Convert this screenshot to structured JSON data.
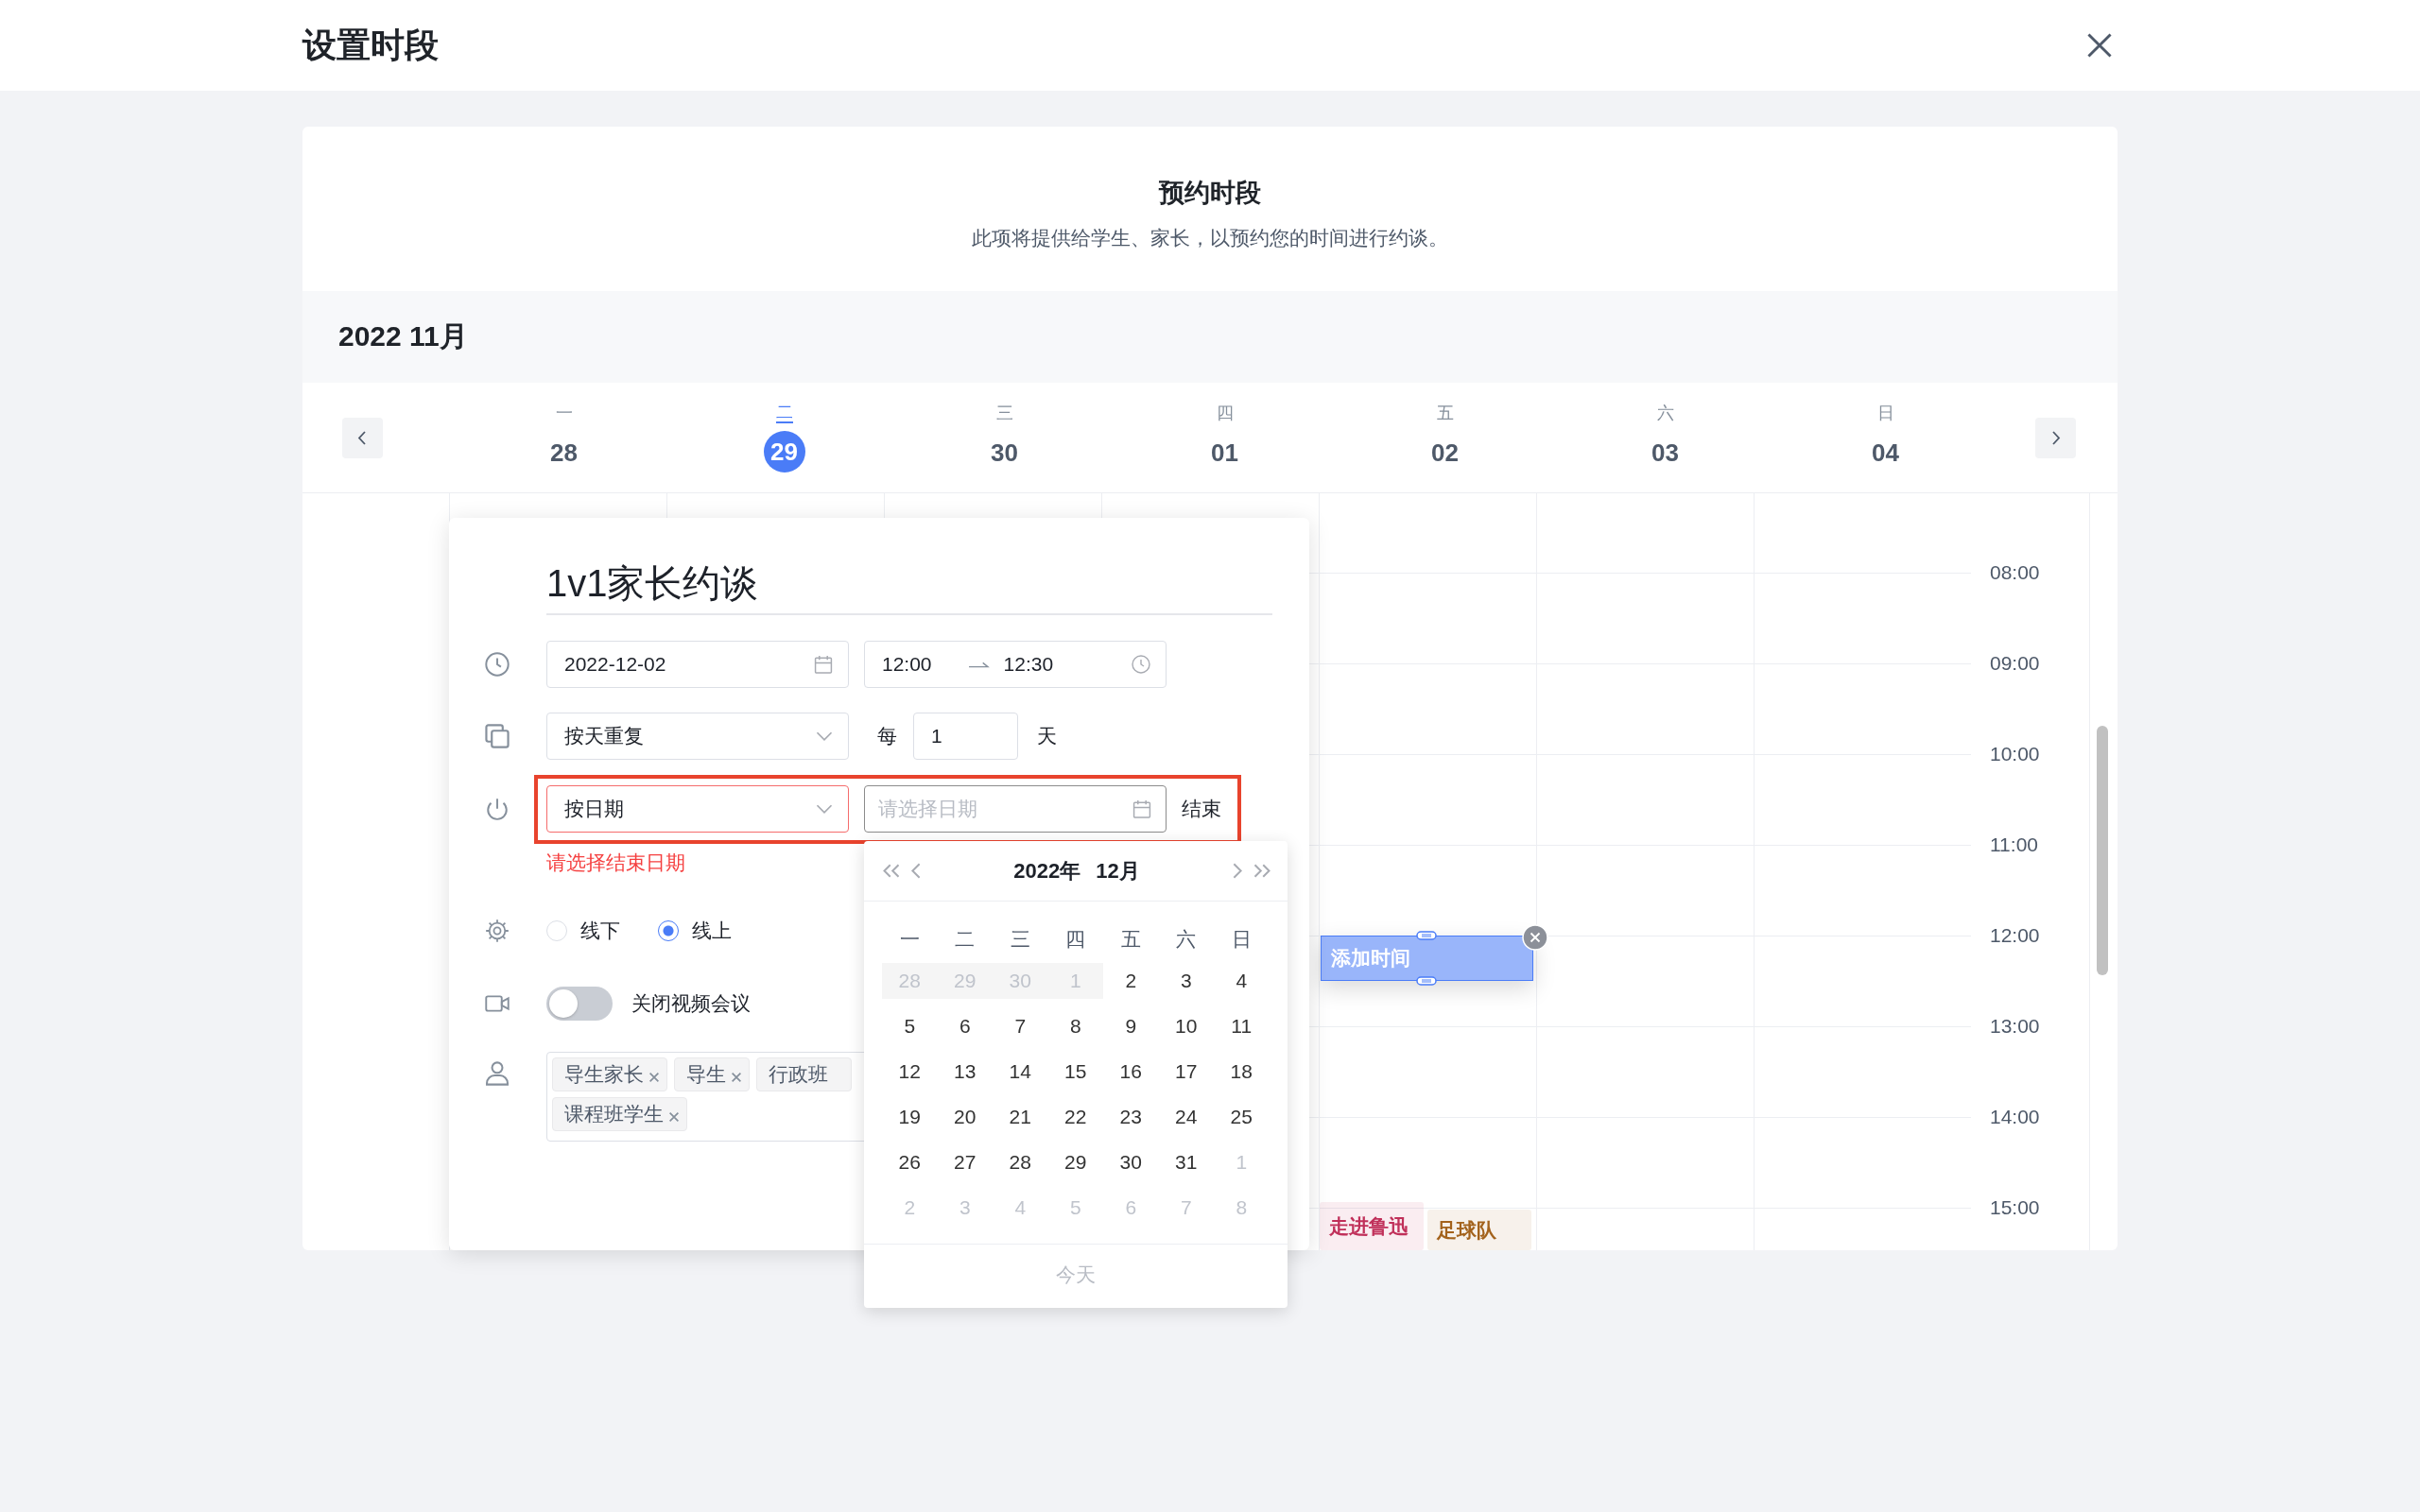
{
  "dialog": {
    "title": "设置时段"
  },
  "intro": {
    "title": "预约时段",
    "subtitle": "此项将提供给学生、家长，以预约您的时间进行约谈。"
  },
  "month_label": "2022 11月",
  "week_days": [
    {
      "weekday": "一",
      "date": "28",
      "selected": false
    },
    {
      "weekday": "二",
      "date": "29",
      "selected": true
    },
    {
      "weekday": "三",
      "date": "30",
      "selected": false
    },
    {
      "weekday": "四",
      "date": "01",
      "selected": false
    },
    {
      "weekday": "五",
      "date": "02",
      "selected": false
    },
    {
      "weekday": "六",
      "date": "03",
      "selected": false
    },
    {
      "weekday": "日",
      "date": "04",
      "selected": false
    }
  ],
  "time_labels": [
    "08:00",
    "09:00",
    "10:00",
    "11:00",
    "12:00",
    "13:00",
    "14:00",
    "15:00"
  ],
  "events": [
    {
      "kind": "draft",
      "title": "添加时间",
      "color": "#4a7cf7"
    },
    {
      "kind": "booked",
      "title": "走进鲁迅",
      "color": "#c0305a"
    },
    {
      "kind": "booked",
      "title": "足球队",
      "color": "#a3621c"
    }
  ],
  "form": {
    "title": "1v1家长约谈",
    "date": "2022-12-02",
    "time_start": "12:00",
    "time_end": "12:30",
    "repeat": "按天重复",
    "every_label": "每",
    "every_value": "1",
    "every_unit": "天",
    "end": {
      "mode": "按日期",
      "date_placeholder": "请选择日期",
      "label": "结束",
      "highlighted": true,
      "error": "请选择结束日期"
    },
    "location_options": [
      {
        "label": "线下",
        "selected": false
      },
      {
        "label": "线上",
        "selected": true
      }
    ],
    "video": {
      "label": "关闭视频会议",
      "on": false
    },
    "participants": [
      {
        "label": "导生家长",
        "removable": true
      },
      {
        "label": "导生",
        "removable": true
      },
      {
        "label": "行政班",
        "removable": false
      },
      {
        "label": "课程班学生",
        "removable": true
      }
    ]
  },
  "date_picker": {
    "year": "2022年",
    "month": "12月",
    "weekdays": [
      "一",
      "二",
      "三",
      "四",
      "五",
      "六",
      "日"
    ],
    "weeks": [
      [
        {
          "day": "28",
          "kind": "disabled"
        },
        {
          "day": "29",
          "kind": "disabled"
        },
        {
          "day": "30",
          "kind": "disabled"
        },
        {
          "day": "1",
          "kind": "disabled"
        },
        {
          "day": "2",
          "kind": "current"
        },
        {
          "day": "3",
          "kind": "current"
        },
        {
          "day": "4",
          "kind": "current"
        }
      ],
      [
        {
          "day": "5",
          "kind": "current"
        },
        {
          "day": "6",
          "kind": "current"
        },
        {
          "day": "7",
          "kind": "current"
        },
        {
          "day": "8",
          "kind": "current"
        },
        {
          "day": "9",
          "kind": "current"
        },
        {
          "day": "10",
          "kind": "current"
        },
        {
          "day": "11",
          "kind": "current"
        }
      ],
      [
        {
          "day": "12",
          "kind": "current"
        },
        {
          "day": "13",
          "kind": "current"
        },
        {
          "day": "14",
          "kind": "current"
        },
        {
          "day": "15",
          "kind": "current"
        },
        {
          "day": "16",
          "kind": "current"
        },
        {
          "day": "17",
          "kind": "current"
        },
        {
          "day": "18",
          "kind": "current"
        }
      ],
      [
        {
          "day": "19",
          "kind": "current"
        },
        {
          "day": "20",
          "kind": "current"
        },
        {
          "day": "21",
          "kind": "current"
        },
        {
          "day": "22",
          "kind": "current"
        },
        {
          "day": "23",
          "kind": "current"
        },
        {
          "day": "24",
          "kind": "current"
        },
        {
          "day": "25",
          "kind": "current"
        }
      ],
      [
        {
          "day": "26",
          "kind": "current"
        },
        {
          "day": "27",
          "kind": "current"
        },
        {
          "day": "28",
          "kind": "current"
        },
        {
          "day": "29",
          "kind": "current"
        },
        {
          "day": "30",
          "kind": "current"
        },
        {
          "day": "31",
          "kind": "current"
        },
        {
          "day": "1",
          "kind": "other"
        }
      ],
      [
        {
          "day": "2",
          "kind": "other"
        },
        {
          "day": "3",
          "kind": "other"
        },
        {
          "day": "4",
          "kind": "other"
        },
        {
          "day": "5",
          "kind": "other"
        },
        {
          "day": "6",
          "kind": "other"
        },
        {
          "day": "7",
          "kind": "other"
        },
        {
          "day": "8",
          "kind": "other"
        }
      ]
    ],
    "today": "今天"
  }
}
